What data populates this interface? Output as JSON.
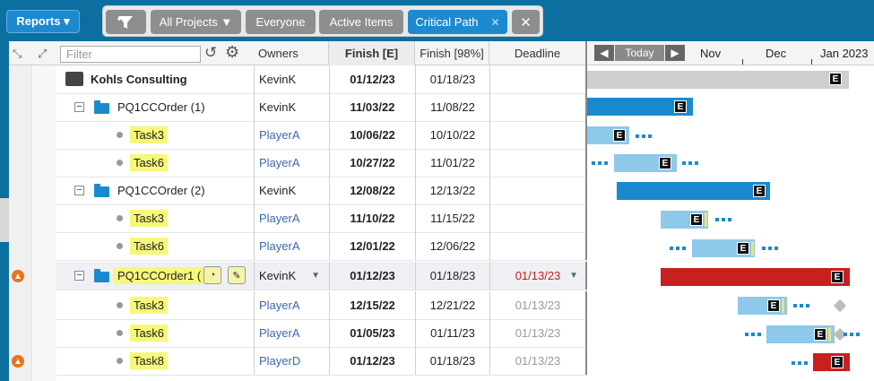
{
  "toolbar": {
    "reports_label": "Reports ▾",
    "filters": [
      {
        "label": "All Projects ▼",
        "active": false
      },
      {
        "label": "Everyone",
        "active": false
      },
      {
        "label": "Active Items",
        "active": false
      },
      {
        "label": "Critical Path",
        "active": true
      }
    ],
    "close_label": "✕",
    "critical_close": "✕"
  },
  "grid": {
    "filter_placeholder": "Filter",
    "columns": {
      "owners": "Owners",
      "finish": "Finish [E]",
      "finish98": "Finish [98%]",
      "deadline": "Deadline"
    },
    "rows": [
      {
        "name": "Kohls Consulting",
        "owner": "KevinK",
        "finish": "01/12/23",
        "finish98": "01/18/23",
        "deadline": ""
      },
      {
        "name": "PQ1CCOrder (1)",
        "owner": "KevinK",
        "finish": "11/03/22",
        "finish98": "11/08/22",
        "deadline": ""
      },
      {
        "name": "Task3",
        "owner": "PlayerA",
        "finish": "10/06/22",
        "finish98": "10/10/22",
        "deadline": ""
      },
      {
        "name": "Task6",
        "owner": "PlayerA",
        "finish": "10/27/22",
        "finish98": "11/01/22",
        "deadline": ""
      },
      {
        "name": "PQ1CCOrder (2)",
        "owner": "KevinK",
        "finish": "12/08/22",
        "finish98": "12/13/22",
        "deadline": ""
      },
      {
        "name": "Task3",
        "owner": "PlayerA",
        "finish": "11/10/22",
        "finish98": "11/15/22",
        "deadline": ""
      },
      {
        "name": "Task6",
        "owner": "PlayerA",
        "finish": "12/01/22",
        "finish98": "12/06/22",
        "deadline": ""
      },
      {
        "name": "PQ1CCOrder1 (",
        "owner": "KevinK",
        "finish": "01/12/23",
        "finish98": "01/18/23",
        "deadline": "01/13/23"
      },
      {
        "name": "Task3",
        "owner": "PlayerA",
        "finish": "12/15/22",
        "finish98": "12/21/22",
        "deadline": "01/13/23"
      },
      {
        "name": "Task6",
        "owner": "PlayerA",
        "finish": "01/05/23",
        "finish98": "01/11/23",
        "deadline": "01/13/23"
      },
      {
        "name": "Task8",
        "owner": "PlayerD",
        "finish": "01/12/23",
        "finish98": "01/18/23",
        "deadline": "01/13/23"
      }
    ]
  },
  "gantt": {
    "today_label": "Today",
    "prev_label": "◀",
    "next_label": "▶",
    "months": [
      "Nov",
      "Dec",
      "Jan 2023"
    ],
    "marker": "E"
  },
  "icons": {
    "warning": "warning-icon",
    "collapse": "collapse-icon",
    "expand": "expand-icon"
  }
}
